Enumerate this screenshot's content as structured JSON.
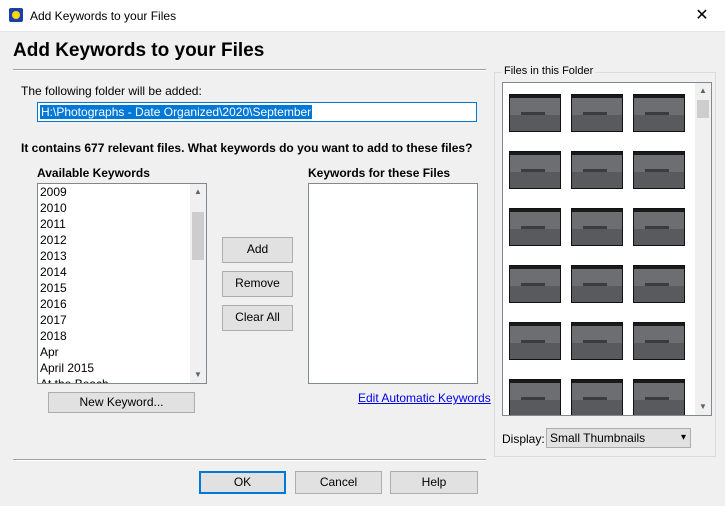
{
  "window": {
    "title": "Add Keywords to your Files",
    "close_glyph": "✕"
  },
  "header": {
    "title": "Add Keywords to your Files"
  },
  "folder": {
    "label": "The following folder will be added:",
    "path": "H:\\Photographs - Date Organized\\2020\\September"
  },
  "summary": "It contains 677 relevant files. What keywords do you want to add to these files?",
  "available": {
    "label": "Available Keywords",
    "items": [
      "2009",
      "2010",
      "2011",
      "2012",
      "2013",
      "2014",
      "2015",
      "2016",
      "2017",
      "2018",
      "Apr",
      "April 2015",
      "At the Beach"
    ],
    "scroll_position": 0.1
  },
  "assigned": {
    "label": "Keywords for these Files",
    "items": []
  },
  "buttons": {
    "add": "Add",
    "remove": "Remove",
    "clear_all": "Clear All",
    "new_keyword": "New Keyword...",
    "ok": "OK",
    "cancel": "Cancel",
    "help": "Help"
  },
  "edit_auto_link": "Edit Automatic Keywords",
  "files_panel": {
    "label": "Files in this Folder",
    "thumb_count": 18,
    "columns": 3
  },
  "display": {
    "label": "Display:",
    "value": "Small Thumbnails"
  },
  "icons": {
    "app": "app-star-icon",
    "close": "close-icon",
    "scroll_up": "chevron-up-icon",
    "scroll_down": "chevron-down-icon",
    "dropdown": "chevron-down-icon"
  },
  "colors": {
    "accent": "#0078d7",
    "link": "#0000ee",
    "window_bg": "#f0f0f0"
  }
}
